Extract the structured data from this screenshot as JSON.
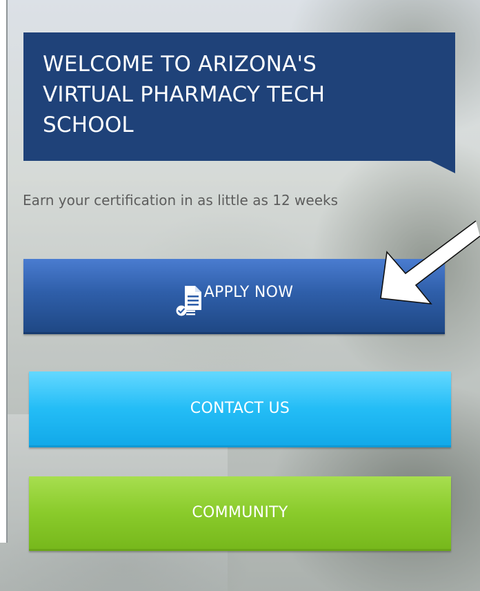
{
  "hero": {
    "title": "WELCOME TO ARIZONA'S\nVIRTUAL PHARMACY TECH\nSCHOOL",
    "subtitle": "Earn your certification in as little as 12 weeks"
  },
  "buttons": {
    "apply": {
      "label": "APPLY NOW",
      "icon": "application-form-icon",
      "color": "#2f5faa"
    },
    "contact": {
      "label": "CONTACT US",
      "color": "#24bdf6"
    },
    "community": {
      "label": "COMMUNITY",
      "color": "#8acb2b"
    }
  },
  "colors": {
    "header_bg": "#1f4279",
    "subtitle_text": "#5d5d5d"
  },
  "annotation": {
    "icon": "arrow-pointer-icon",
    "color": "#ffffff"
  }
}
